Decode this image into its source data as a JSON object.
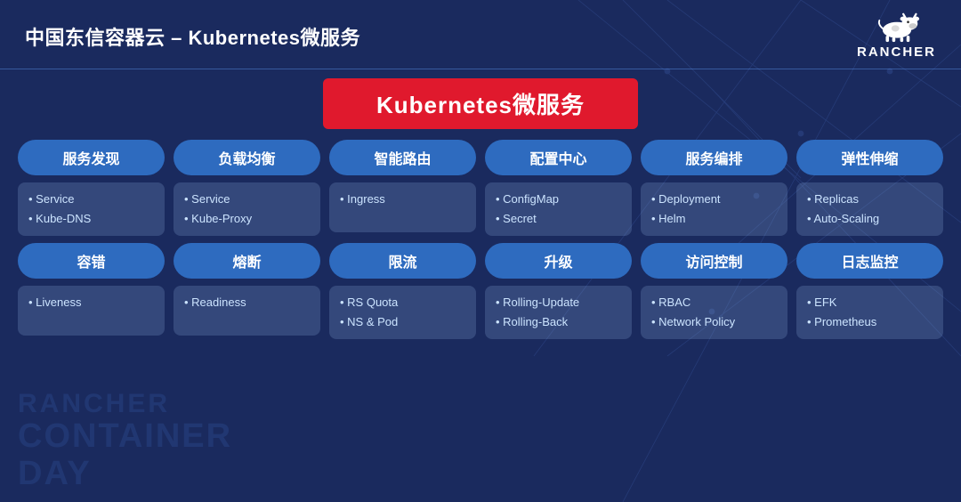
{
  "header": {
    "title": "中国东信容器云 – Kubernetes微服务",
    "rancher_label": "RANCHER"
  },
  "top_box": {
    "label": "Kubernetes微服务"
  },
  "row1": [
    {
      "pill": "服务发现",
      "items": [
        "Service",
        "Kube-DNS"
      ]
    },
    {
      "pill": "负载均衡",
      "items": [
        "Service",
        "Kube-Proxy"
      ]
    },
    {
      "pill": "智能路由",
      "items": [
        "Ingress"
      ]
    },
    {
      "pill": "配置中心",
      "items": [
        "ConfigMap",
        "Secret"
      ]
    },
    {
      "pill": "服务编排",
      "items": [
        "Deployment",
        "Helm"
      ]
    },
    {
      "pill": "弹性伸缩",
      "items": [
        "Replicas",
        "Auto-Scaling"
      ]
    }
  ],
  "row2": [
    {
      "pill": "容错",
      "items": [
        "Liveness"
      ]
    },
    {
      "pill": "熔断",
      "items": [
        "Readiness"
      ]
    },
    {
      "pill": "限流",
      "items": [
        "RS Quota",
        "NS & Pod"
      ]
    },
    {
      "pill": "升级",
      "items": [
        "Rolling-Update",
        "Rolling-Back"
      ]
    },
    {
      "pill": "访问控制",
      "items": [
        "RBAC",
        "Network Policy"
      ]
    },
    {
      "pill": "日志监控",
      "items": [
        "EFK",
        "Prometheus"
      ]
    }
  ],
  "watermark": {
    "line1": "RANCHER",
    "line2": "CONTAINER",
    "line3": "DAY"
  }
}
